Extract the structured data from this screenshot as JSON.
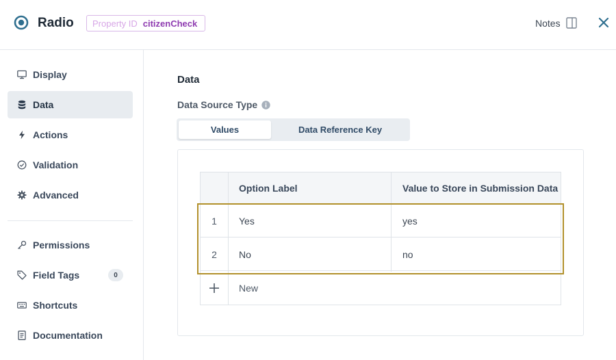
{
  "header": {
    "title": "Radio",
    "property_id_label": "Property ID",
    "property_id_value": "citizenCheck",
    "notes_label": "Notes"
  },
  "sidebar": {
    "items": [
      {
        "label": "Display",
        "icon": "monitor-icon",
        "active": false
      },
      {
        "label": "Data",
        "icon": "database-icon",
        "active": true
      },
      {
        "label": "Actions",
        "icon": "lightning-icon",
        "active": false
      },
      {
        "label": "Validation",
        "icon": "check-circle-icon",
        "active": false
      },
      {
        "label": "Advanced",
        "icon": "gear-icon",
        "active": false
      },
      {
        "label": "Permissions",
        "icon": "key-icon",
        "active": false
      },
      {
        "label": "Field Tags",
        "icon": "tag-icon",
        "active": false,
        "badge": "0"
      },
      {
        "label": "Shortcuts",
        "icon": "keyboard-icon",
        "active": false
      },
      {
        "label": "Documentation",
        "icon": "document-icon",
        "active": false
      }
    ]
  },
  "main": {
    "section_title": "Data",
    "data_source_label": "Data Source Type",
    "segments": {
      "values": "Values",
      "reference": "Data Reference Key",
      "selected": "Values"
    },
    "table": {
      "columns": [
        "Option Label",
        "Value to Store in Submission Data"
      ],
      "rows": [
        {
          "index": "1",
          "label": "Yes",
          "value": "yes"
        },
        {
          "index": "2",
          "label": "No",
          "value": "no"
        }
      ],
      "new_label": "New"
    }
  },
  "colors": {
    "accent": "#2f6f8f",
    "highlight": "#b1902a",
    "badge_border": "#d9b8e8",
    "badge_value": "#8e3bb0"
  }
}
